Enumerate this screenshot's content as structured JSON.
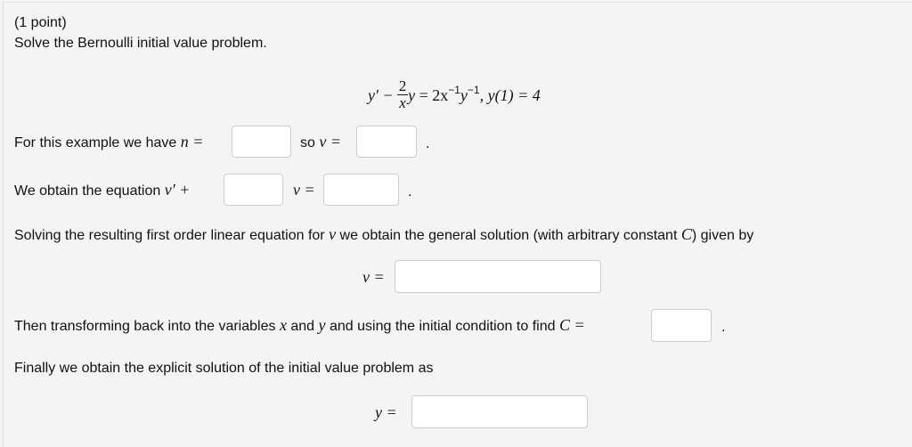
{
  "header": {
    "points": "(1 point)",
    "instruction": "Solve the Bernoulli initial value problem."
  },
  "equation": {
    "lhs_prefix": "y′ − ",
    "frac_num": "2",
    "frac_den": "x",
    "lhs_y": "y",
    "equals": " = 2x",
    "exp1": "−1",
    "y2": "y",
    "exp2": "−1",
    "condition": ",  y(1) = 4"
  },
  "line_n": {
    "text": "For this example we have ",
    "var": "n =",
    "so_text": "so ",
    "v_var": "v =",
    "period": ".",
    "n_value": "",
    "v_value": ""
  },
  "line_eq": {
    "text": "We obtain the equation ",
    "var": "v′ +",
    "v_var": "v =",
    "period": ".",
    "coef_value": "",
    "rhs_value": ""
  },
  "line_general": {
    "text_before": "Solving the resulting first order linear equation for ",
    "var_v": "v",
    "text_mid": " we obtain the general solution (with arbitrary constant ",
    "var_c": "C",
    "text_after": ") given by",
    "v_label": "v =",
    "v_value": ""
  },
  "line_c": {
    "text_before": "Then transforming back into the variables ",
    "var_x": "x",
    "text_and": " and ",
    "var_y": "y",
    "text_after": " and using the initial condition to find ",
    "c_label": "C =",
    "period": ".",
    "c_value": ""
  },
  "line_final": {
    "text": "Finally we obtain the explicit solution of the initial value problem as",
    "y_label": "y =",
    "y_value": ""
  }
}
